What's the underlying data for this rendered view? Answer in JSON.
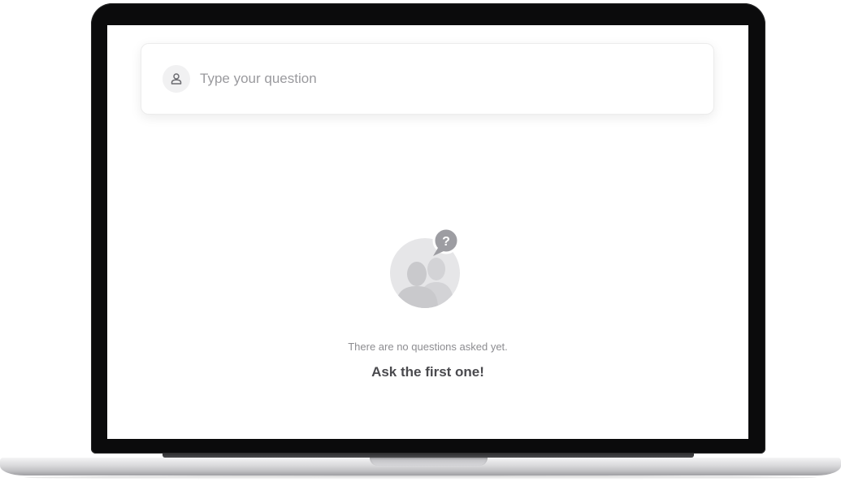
{
  "question_box": {
    "placeholder": "Type your question",
    "value": "",
    "avatar_icon": "user-icon"
  },
  "empty_state": {
    "illustration_icon": "people-question-icon",
    "message": "There are no questions asked yet.",
    "cta": "Ask the first one!"
  },
  "colors": {
    "bezel": "#0b0b0c",
    "screen_bg": "#ffffff",
    "muted_text": "#8d8d91",
    "cta_text": "#4a4a4e",
    "illustration_gray": "#d9d9dc"
  }
}
